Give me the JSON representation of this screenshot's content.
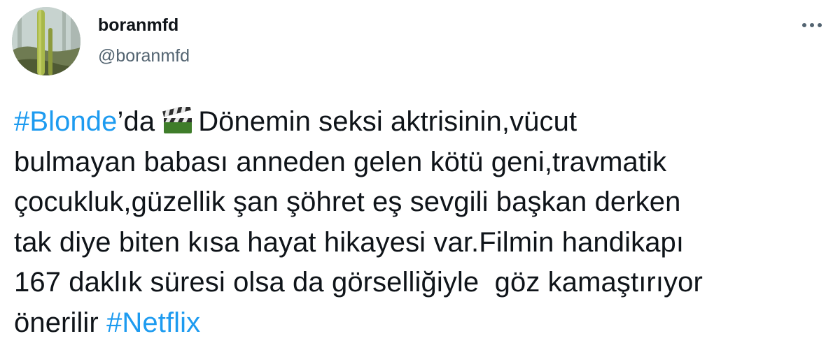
{
  "user": {
    "name": "boranmfd",
    "handle": "@boranmfd",
    "avatar_icon": "profile-avatar"
  },
  "menu": {
    "icon": "more-options-icon"
  },
  "tweet": {
    "hashtag1": "#Blonde",
    "after_hashtag1": "’da",
    "emoji_icon": "clapper-board-icon",
    "line1_rest": "Dönemin seksi aktrisinin,vücut",
    "line2": "bulmayan babası anneden gelen kötü geni,travmatik",
    "line3": "çocukluk,güzellik şan şöhret eş sevgili başkan derken",
    "line4": "tak diye biten kısa hayat hikayesi var.Filmin handikapı",
    "line5": "167 daklık süresi olsa da görselliğiyle  göz kamaştırıyor",
    "line6_pre": "önerilir",
    "hashtag2": "#Netflix"
  },
  "colors": {
    "text": "#0f1419",
    "secondary": "#536471",
    "link": "#1d9bf0",
    "background": "#ffffff"
  }
}
